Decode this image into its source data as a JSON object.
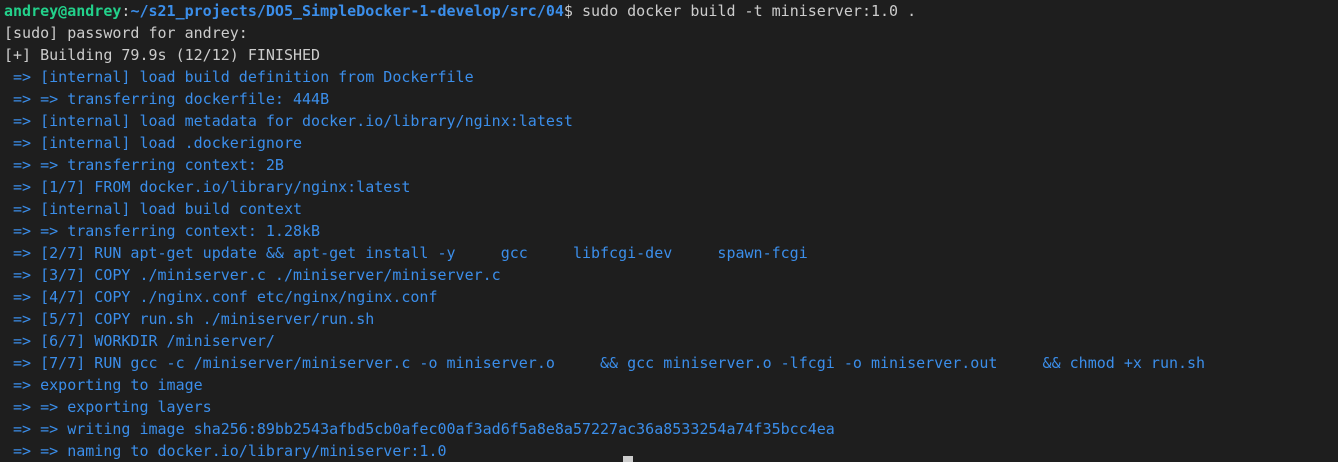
{
  "prompt": {
    "user_host": "andrey@andrey",
    "separator": ":",
    "path": "~/s21_projects/DO5_SimpleDocker-1-develop/src/04",
    "symbol": "$",
    "command": " sudo docker build -t miniserver:1.0 ."
  },
  "sudo_line": "[sudo] password for andrey:",
  "building_line": "[+] Building 79.9s (12/12) FINISHED",
  "build_steps": [
    " => [internal] load build definition from Dockerfile",
    " => => transferring dockerfile: 444B",
    " => [internal] load metadata for docker.io/library/nginx:latest",
    " => [internal] load .dockerignore",
    " => => transferring context: 2B",
    " => [1/7] FROM docker.io/library/nginx:latest",
    " => [internal] load build context",
    " => => transferring context: 1.28kB",
    " => [2/7] RUN apt-get update && apt-get install -y     gcc     libfcgi-dev     spawn-fcgi",
    " => [3/7] COPY ./miniserver.c ./miniserver/miniserver.c",
    " => [4/7] COPY ./nginx.conf etc/nginx/nginx.conf",
    " => [5/7] COPY run.sh ./miniserver/run.sh",
    " => [6/7] WORKDIR /miniserver/",
    " => [7/7] RUN gcc -c /miniserver/miniserver.c -o miniserver.o     && gcc miniserver.o -lfcgi -o miniserver.out     && chmod +x run.sh",
    " => exporting to image",
    " => => exporting layers",
    " => => writing image sha256:89bb2543afbd5cb0afec00af3ad6f5a8e8a57227ac36a8533254a74f35bcc4ea",
    " => => naming to docker.io/library/miniserver:1.0"
  ],
  "colors": {
    "background": "#1e1e1e",
    "foreground": "#cccccc",
    "user": "#23d18b",
    "path": "#3b8eea",
    "steps": "#3b8eea"
  }
}
